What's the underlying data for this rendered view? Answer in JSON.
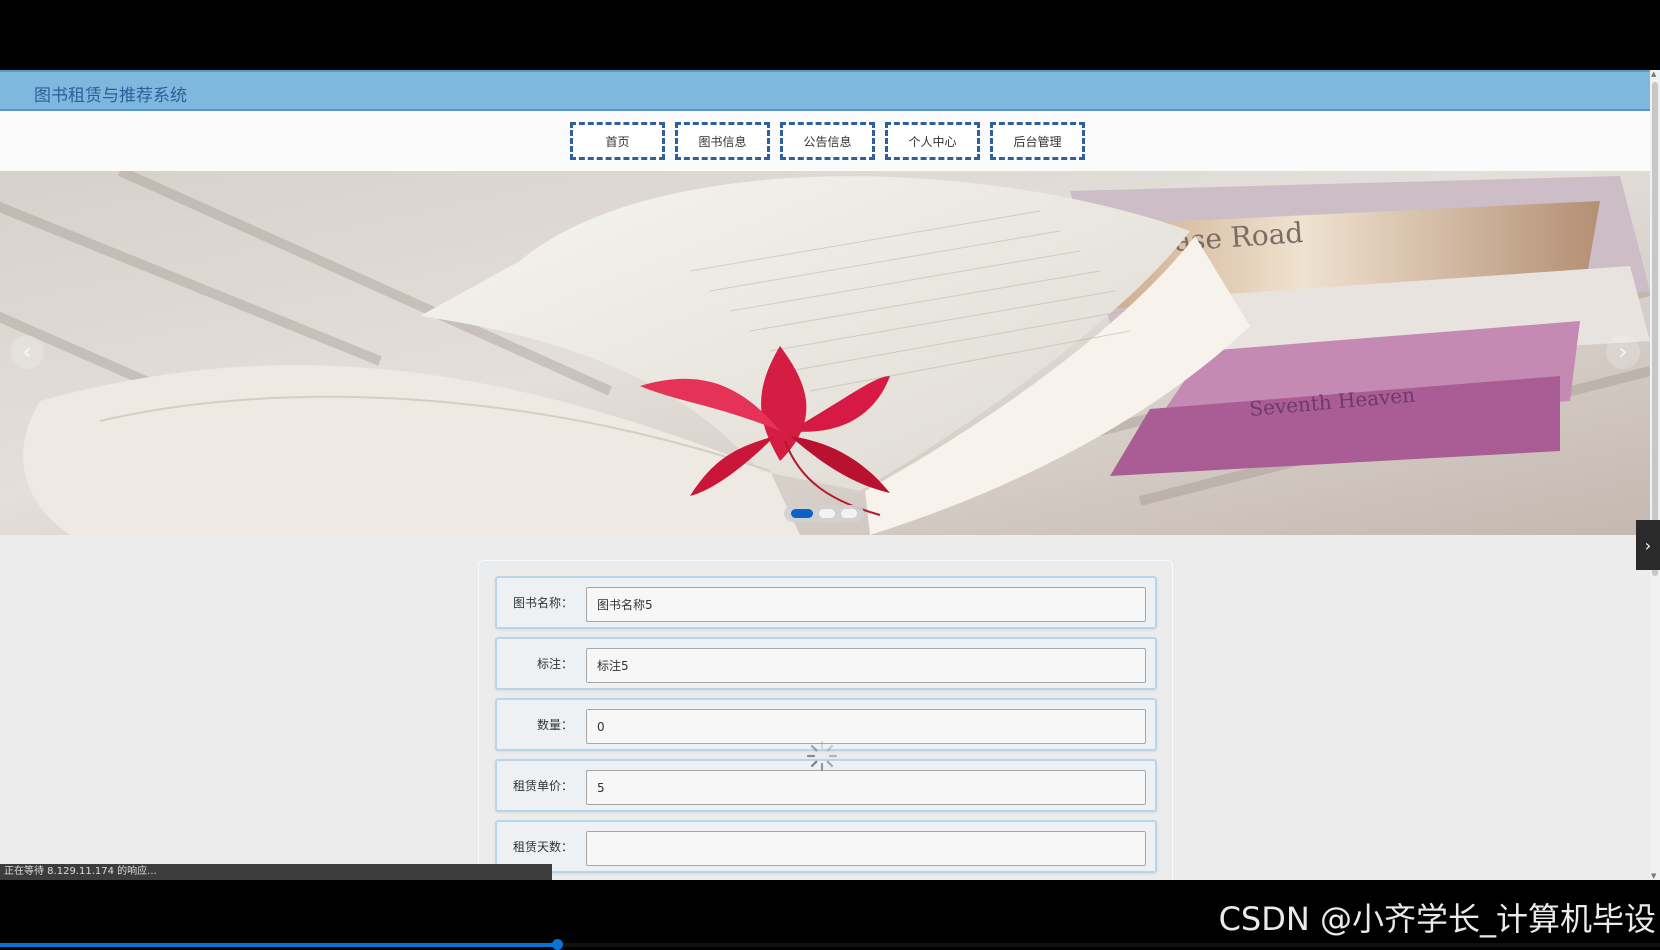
{
  "site": {
    "title": "图书租赁与推荐系统"
  },
  "nav": {
    "items": [
      "首页",
      "图书信息",
      "公告信息",
      "个人中心",
      "后台管理"
    ]
  },
  "banner": {
    "slide_count": 3,
    "active_slide": 1
  },
  "form": {
    "fields": [
      {
        "label": "图书名称：",
        "value": "图书名称5"
      },
      {
        "label": "标注：",
        "value": "标注5"
      },
      {
        "label": "数量：",
        "value": "0"
      },
      {
        "label": "租赁单价：",
        "value": "5"
      },
      {
        "label": "租赁天数：",
        "value": ""
      }
    ]
  },
  "status": {
    "text": "正在等待 8.129.11.174 的响应..."
  },
  "watermark": {
    "text": "CSDN @小齐学长_计算机毕设"
  },
  "colors": {
    "header": "#7fb8df",
    "nav_border": "#2f5f9f",
    "active_dot": "#0b62c9"
  }
}
